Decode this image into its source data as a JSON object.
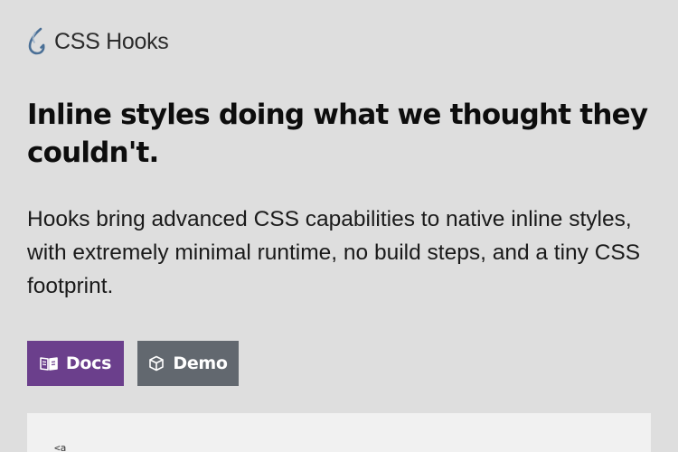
{
  "brand": {
    "name": "CSS Hooks",
    "icon": "hook-icon",
    "color": "#4a6f96"
  },
  "hero": {
    "headline": "Inline styles doing what we thought they couldn't.",
    "lead": "Hooks bring advanced CSS capabilities to native inline styles, with extremely minimal runtime, no build steps, and a tiny CSS footprint."
  },
  "actions": {
    "docs": {
      "label": "Docs",
      "icon": "book-icon",
      "color": "#6b3f8c"
    },
    "demo": {
      "label": "Demo",
      "icon": "cube-icon",
      "color": "#62686f"
    }
  },
  "code": {
    "first_line": "<a"
  }
}
